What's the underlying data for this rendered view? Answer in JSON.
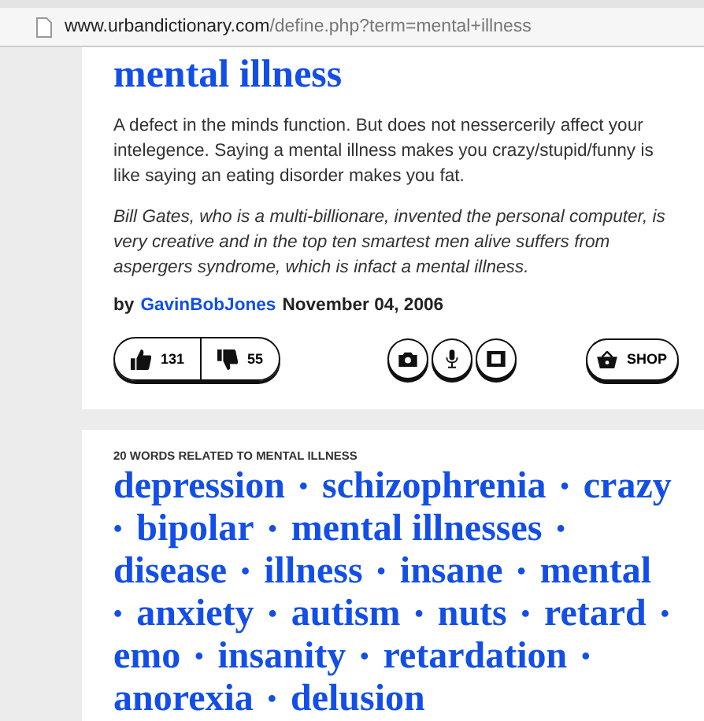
{
  "address_bar": {
    "domain": "www.urbandictionary.com",
    "path": "/define.php?term=mental+illness"
  },
  "definition": {
    "word": "mental illness",
    "meaning": "A defect in the minds function. But does not nessercerily affect your intelegence. Saying a mental illness makes you crazy/stupid/funny is like saying an eating disorder makes you fat.",
    "example": "Bill Gates, who is a multi-billionare, invented the personal computer, is very creative and in the top ten smartest men alive suffers from aspergers syndrome, which is infact a mental illness.",
    "by": "by",
    "author": "GavinBobJones",
    "date": "November 04, 2006",
    "upvotes": "131",
    "downvotes": "55",
    "shop": "SHOP"
  },
  "related": {
    "heading": "20 WORDS RELATED TO MENTAL ILLNESS",
    "separator": "•",
    "words": [
      "depression",
      "schizophrenia",
      "crazy",
      "bipolar",
      "mental illnesses",
      "disease",
      "illness",
      "insane",
      "mental",
      "anxiety",
      "autism",
      "nuts",
      "retard",
      "emo",
      "insanity",
      "retardation",
      "anorexia",
      "delusion"
    ]
  }
}
